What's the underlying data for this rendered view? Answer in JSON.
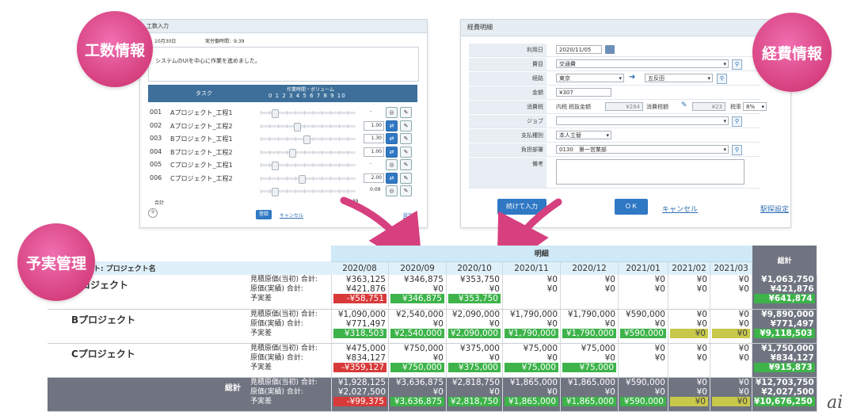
{
  "task_window": {
    "title": "工数入力",
    "date_label": "10月30日",
    "work_time_label": "実労働時間：9:39",
    "memo": "システムのUIを中心に作業を進めました。",
    "col_task": "タスク",
    "col_volume": "作業時間・ボリューム",
    "scale": "0 1 2 3 4 5 6 7 8 9 10",
    "rows": [
      {
        "no": "001",
        "task": "Aプロジェクト_工程1",
        "value": "-",
        "has_box": false
      },
      {
        "no": "002",
        "task": "Aプロジェクト_工程2",
        "value": "1.00",
        "has_box": true
      },
      {
        "no": "003",
        "task": "Bプロジェクト_工程1",
        "value": "1.30",
        "has_box": true
      },
      {
        "no": "004",
        "task": "Bプロジェクト_工程2",
        "value": "1.00",
        "has_box": true
      },
      {
        "no": "005",
        "task": "Cプロジェクト_工程1",
        "value": "-",
        "has_box": false
      },
      {
        "no": "006",
        "task": "Cプロジェクト_工程2",
        "value": "2.00",
        "has_box": true
      },
      {
        "no": "",
        "task": "",
        "value": "0:09",
        "has_box": false
      }
    ],
    "total_label": "合計",
    "total_value": "9:39",
    "register_label": "登録",
    "cancel_label": "キャンセル",
    "settings_label": "設定"
  },
  "expense_window": {
    "title": "経費明細",
    "fields": {
      "date_label": "利用日",
      "date_value": "2020/11/05",
      "item_label": "費目",
      "item_value": "交通費",
      "route_label": "経路",
      "route_from": "東京",
      "route_to": "五反田",
      "amount_label": "金額",
      "amount_value": "¥307",
      "tax_label": "消費税",
      "tax_inc_label": "内税",
      "tax_amount_label": "税抜金額",
      "tax_amount_value": "¥284",
      "tax_value_label": "消費税額",
      "tax_value": "¥23",
      "tax_rate_label": "税率",
      "tax_rate_value": "8%",
      "job_label": "ジョブ",
      "job_value": "",
      "payment_label": "支払種別",
      "payment_value": "本人立替",
      "dept_label": "負担部署",
      "dept_value": "0130　第一営業部",
      "note_label": "備考",
      "note_value": ""
    },
    "continue_label": "続けて入力",
    "ok_label": "ＯＫ",
    "cancel_label": "キャンセル",
    "station_label": "駅探設定"
  },
  "bubbles": {
    "work": "工数情報",
    "expense": "経費情報",
    "budget": "予実管理"
  },
  "budget_table": {
    "detail_header": "明細",
    "total_header": "総計",
    "project_header": "ト: プロジェクト名",
    "months": [
      "2020/08",
      "2020/09",
      "2020/10",
      "2020/11",
      "2020/12",
      "2021/01",
      "2021/02",
      "2021/03"
    ],
    "labels": [
      "見積原価(当初) 合計:",
      "原価(実績) 合計:",
      "予実差"
    ],
    "projects": [
      {
        "name": "プロジェクト",
        "cells": [
          [
            "¥363,125",
            "¥421,876",
            "-¥58,751"
          ],
          [
            "¥346,875",
            "¥0",
            "¥346,875"
          ],
          [
            "¥353,750",
            "¥0",
            "¥353,750"
          ],
          [
            "¥0",
            "¥0",
            ""
          ],
          [
            "¥0",
            "¥0",
            ""
          ],
          [
            "¥0",
            "¥0",
            ""
          ],
          [
            "¥0",
            "¥0",
            ""
          ],
          [
            "¥0",
            "¥0",
            ""
          ]
        ],
        "diff_style": [
          "neg",
          "pos",
          "pos",
          "",
          "",
          "",
          "",
          ""
        ],
        "total": [
          "¥1,063,750",
          "¥421,876",
          "¥641,874"
        ]
      },
      {
        "name": "Bプロジェクト",
        "cells": [
          [
            "¥1,090,000",
            "¥771,497",
            "¥318,503"
          ],
          [
            "¥2,540,000",
            "¥0",
            "¥2,540,000"
          ],
          [
            "¥2,090,000",
            "¥0",
            "¥2,090,000"
          ],
          [
            "¥1,790,000",
            "¥0",
            "¥1,790,000"
          ],
          [
            "¥1,790,000",
            "¥0",
            "¥1,790,000"
          ],
          [
            "¥590,000",
            "¥0",
            "¥590,000"
          ],
          [
            "¥0",
            "¥0",
            "¥0"
          ],
          [
            "¥0",
            "¥0",
            "¥0"
          ]
        ],
        "diff_style": [
          "pos",
          "pos",
          "pos",
          "pos",
          "pos",
          "pos",
          "zero",
          "zero"
        ],
        "total": [
          "¥9,890,000",
          "¥771,497",
          "¥9,118,503"
        ]
      },
      {
        "name": "Cプロジェクト",
        "cells": [
          [
            "¥475,000",
            "¥834,127",
            "-¥359,127"
          ],
          [
            "¥750,000",
            "¥0",
            "¥750,000"
          ],
          [
            "¥375,000",
            "¥0",
            "¥375,000"
          ],
          [
            "¥75,000",
            "¥0",
            "¥75,000"
          ],
          [
            "¥75,000",
            "¥0",
            "¥75,000"
          ],
          [
            "¥0",
            "¥0",
            ""
          ],
          [
            "¥0",
            "¥0",
            ""
          ],
          [
            "¥0",
            "¥0",
            ""
          ]
        ],
        "diff_style": [
          "neg",
          "pos",
          "pos",
          "pos",
          "pos",
          "",
          "",
          ""
        ],
        "total": [
          "¥1,750,000",
          "¥834,127",
          "¥915,873"
        ]
      }
    ],
    "grand": {
      "name": "総計",
      "cells": [
        [
          "¥1,928,125",
          "¥2,027,500",
          "-¥99,375"
        ],
        [
          "¥3,636,875",
          "¥0",
          "¥3,636,875"
        ],
        [
          "¥2,818,750",
          "¥0",
          "¥2,818,750"
        ],
        [
          "¥1,865,000",
          "¥0",
          "¥1,865,000"
        ],
        [
          "¥1,865,000",
          "¥0",
          "¥1,865,000"
        ],
        [
          "¥590,000",
          "¥0",
          "¥590,000"
        ],
        [
          "¥0",
          "¥0",
          "¥0"
        ],
        [
          "¥0",
          "¥0",
          "¥0"
        ]
      ],
      "diff_style": [
        "neg",
        "pos",
        "pos",
        "pos",
        "pos",
        "pos",
        "zero",
        "zero"
      ],
      "total": [
        "¥12,703,750",
        "¥2,027,500",
        "¥10,676,250"
      ]
    }
  },
  "watermark": "ai",
  "colors": {
    "accent_pink": "#d6407f",
    "header_blue": "#cfe9f6",
    "positive": "#3db34a",
    "negative": "#d83a3a",
    "zero": "#c8c84a",
    "total_dark": "#6f7480"
  }
}
